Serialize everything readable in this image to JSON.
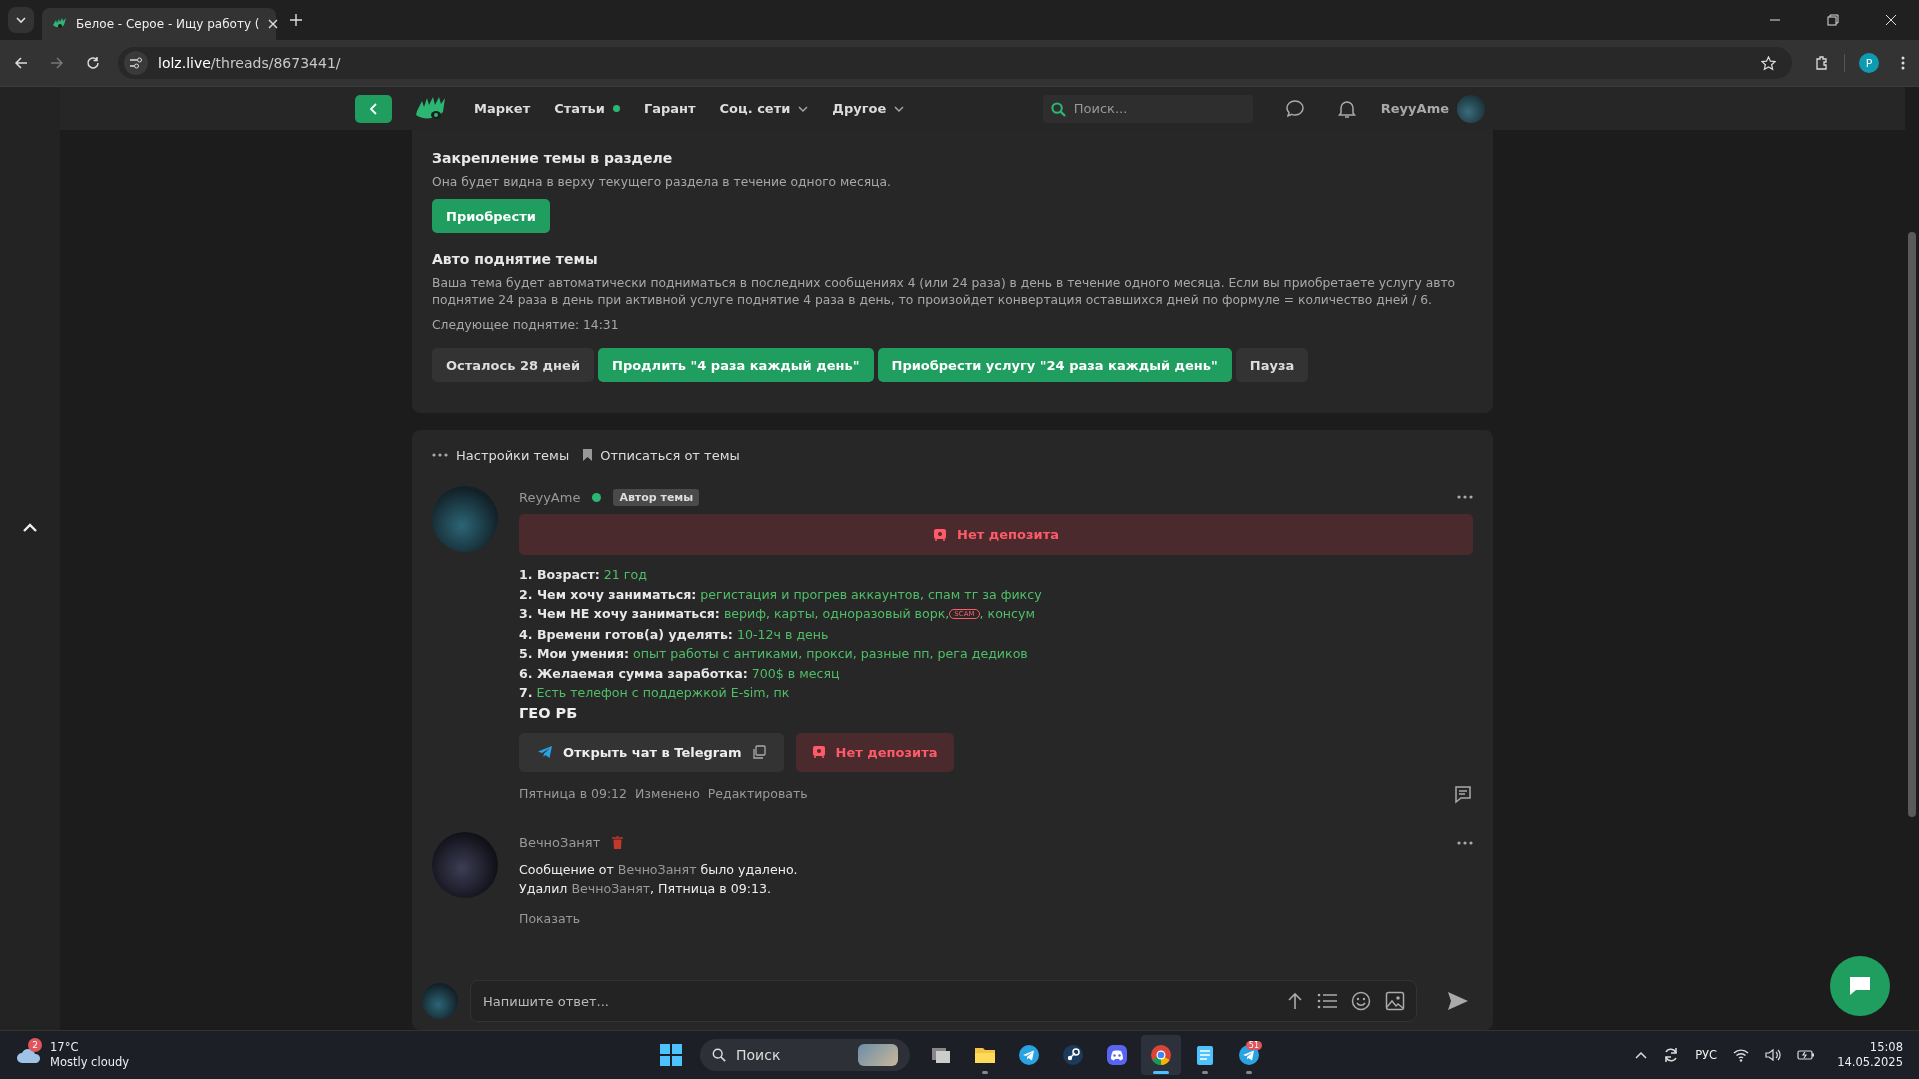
{
  "browser": {
    "tab_title": "Белое - Серое - Ищу работу (",
    "url_host": "lolz.live",
    "url_path": "/threads/8673441/",
    "profile_initial": "P"
  },
  "site_nav": {
    "items": [
      {
        "label": "Маркет",
        "dot": false,
        "dropdown": false
      },
      {
        "label": "Статьи",
        "dot": true,
        "dropdown": false
      },
      {
        "label": "Гарант",
        "dot": false,
        "dropdown": false
      },
      {
        "label": "Соц. сети",
        "dot": false,
        "dropdown": true
      },
      {
        "label": "Другое",
        "dot": false,
        "dropdown": true
      }
    ],
    "search_placeholder": "Поиск...",
    "username": "ReyyAme"
  },
  "promote": {
    "pin": {
      "title": "Закрепление темы в разделе",
      "description": "Она будет видна в верху текущего раздела в течение одного месяца.",
      "button": "Приобрести"
    },
    "auto_bump": {
      "title": "Авто поднятие темы",
      "description": "Ваша тема будет автоматически подниматься в последних сообщениях 4 (или 24 раза) в день в течение одного месяца. Если вы приобретаете услугу авто поднятие 24 раза в день при активной услуге поднятие 4 раза в день, то произойдет конвертация оставшихся дней по формуле = количество дней / 6.",
      "next_bump": "Следующее поднятие: 14:31",
      "buttons": [
        {
          "label": "Осталось 28 дней",
          "kind": "neutral"
        },
        {
          "label": "Продлить \"4 раза каждый день\"",
          "kind": "primary"
        },
        {
          "label": "Приобрести услугу \"24 раза каждый день\"",
          "kind": "primary"
        },
        {
          "label": "Пауза",
          "kind": "neutral"
        }
      ]
    }
  },
  "thread_actions": [
    "Настройки темы",
    "Отписаться от темы"
  ],
  "post": {
    "author": "ReyyAme",
    "online": true,
    "badge": "Автор темы",
    "deposit_banner": "Нет депозита",
    "fields": [
      {
        "label": "1. Возраст:",
        "value": "21 год"
      },
      {
        "label": "2. Чем хочу заниматься:",
        "value": "регистация и прогрев аккаунтов, спам тг за фиксу"
      },
      {
        "label": "3. Чем НЕ хочу заниматься:",
        "value": "вериф, карты, одноразовый ворк,",
        "tag": "SCAM",
        "value_after": ", консум"
      },
      {
        "label": "4. Времени готов(а) уделять:",
        "value": "10-12ч в день"
      },
      {
        "label": "5. Мои умения:",
        "value": "опыт работы с антиками, прокси, разные пп, рега дедиков"
      },
      {
        "label": "6. Желаемая сумма заработка:",
        "value": "700$ в месяц"
      },
      {
        "label": "7.",
        "value": "Есть телефон с поддержкой E-sim, пк"
      }
    ],
    "geo": "ГЕО РБ",
    "telegram_button": "Открыть чат в Telegram",
    "deposit_button": "Нет депозита",
    "date": "Пятница в 09:12",
    "edited": "Изменено",
    "edit_link": "Редактировать"
  },
  "deleted_post": {
    "author": "ВечноЗанят",
    "line1": [
      "Сообщение от ",
      "ВечноЗанят",
      " было удалено."
    ],
    "line2": [
      "Удалил ",
      "ВечноЗанят",
      ", Пятница в 09:13."
    ],
    "show": "Показать"
  },
  "reply": {
    "placeholder": "Напишите ответ..."
  },
  "taskbar": {
    "weather_badge": "2",
    "temperature": "17°C",
    "condition": "Mostly cloudy",
    "search": "Поиск",
    "apps": [
      {
        "kind": "files",
        "running": false,
        "active": false
      },
      {
        "kind": "folder",
        "running": true,
        "active": false
      },
      {
        "kind": "telegram",
        "running": false,
        "active": false
      },
      {
        "kind": "steam",
        "running": false,
        "active": false
      },
      {
        "kind": "discord",
        "running": false,
        "active": false
      },
      {
        "kind": "chrome",
        "running": true,
        "active": true
      },
      {
        "kind": "notepad",
        "running": true,
        "active": false
      },
      {
        "kind": "telegram",
        "running": true,
        "active": false,
        "badge": "51"
      }
    ],
    "language": "РУС",
    "time": "15:08",
    "date": "14.05.2025"
  }
}
